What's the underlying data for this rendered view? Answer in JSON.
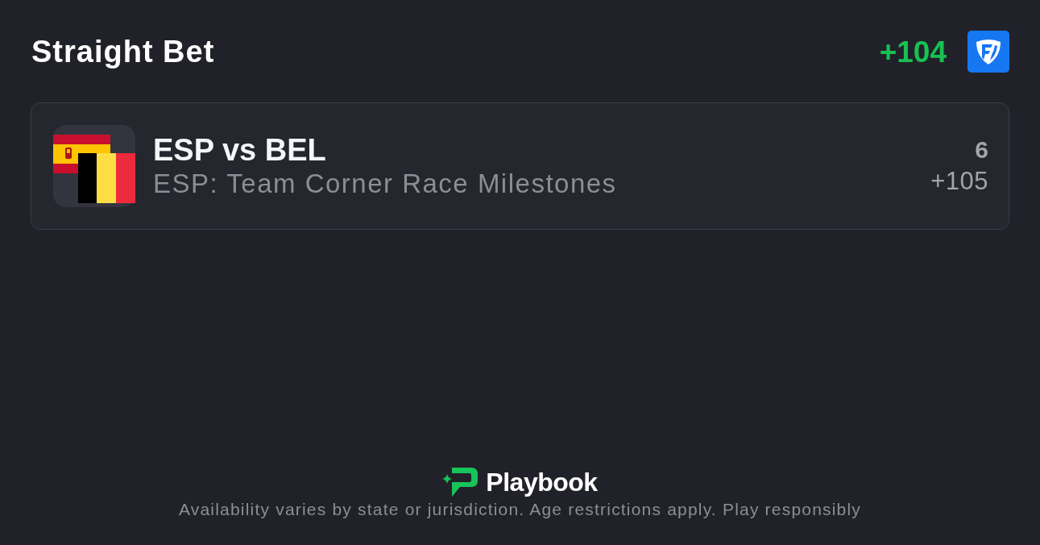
{
  "header": {
    "title": "Straight Bet",
    "odds": "+104"
  },
  "bet": {
    "matchup": "ESP vs BEL",
    "market": "ESP: Team Corner Race Milestones",
    "line": "6",
    "odds": "+105"
  },
  "footer": {
    "brand": "Playbook",
    "disclaimer": "Availability varies by state or jurisdiction. Age restrictions apply. Play responsibly"
  }
}
